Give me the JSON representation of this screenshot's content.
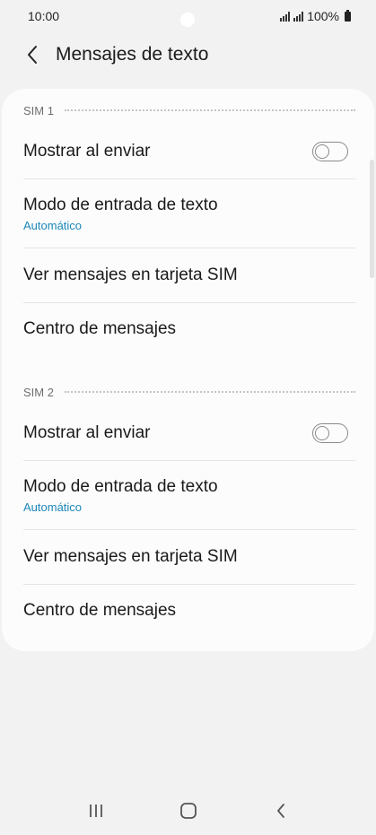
{
  "status_bar": {
    "time": "10:00",
    "battery_text": "100%",
    "icons": [
      "signal-icon",
      "signal-icon",
      "battery-icon"
    ]
  },
  "app_bar": {
    "back_icon": "chevron-left-icon",
    "title": "Mensajes de texto"
  },
  "sections": [
    {
      "label": "SIM 1",
      "items": [
        {
          "title": "Mostrar al enviar",
          "type": "toggle",
          "on": false
        },
        {
          "title": "Modo de entrada de texto",
          "subtitle": "Automático"
        },
        {
          "title": "Ver mensajes en tarjeta SIM"
        },
        {
          "title": "Centro de mensajes"
        }
      ]
    },
    {
      "label": "SIM 2",
      "items": [
        {
          "title": "Mostrar al enviar",
          "type": "toggle",
          "on": false
        },
        {
          "title": "Modo de entrada de texto",
          "subtitle": "Automático"
        },
        {
          "title": "Ver mensajes en tarjeta SIM"
        },
        {
          "title": "Centro de mensajes"
        }
      ]
    }
  ],
  "colors": {
    "background": "#f2f2f2",
    "card": "#fcfcfc",
    "accent": "#1e87b8",
    "divider": "#e4e4e4"
  },
  "nav_bar": {
    "icons": [
      "recent-apps-icon",
      "home-icon",
      "back-icon"
    ]
  }
}
